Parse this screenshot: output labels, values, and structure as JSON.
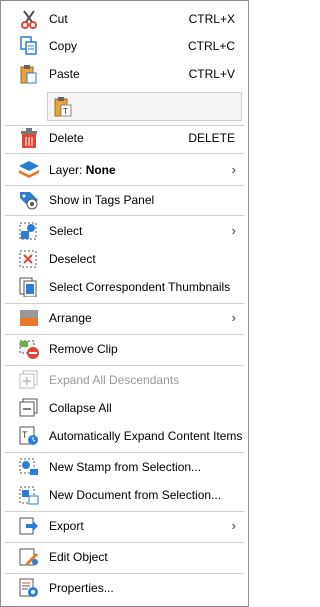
{
  "menu": {
    "cut": {
      "label": "Cut",
      "shortcut": "CTRL+X"
    },
    "copy": {
      "label": "Copy",
      "shortcut": "CTRL+C"
    },
    "paste": {
      "label": "Paste",
      "shortcut": "CTRL+V"
    },
    "delete": {
      "label": "Delete",
      "shortcut": "DELETE"
    },
    "layer": {
      "label": "Layer: ",
      "value": "None"
    },
    "show_in_tags": {
      "label": "Show in Tags Panel"
    },
    "select": {
      "label": "Select"
    },
    "deselect": {
      "label": "Deselect"
    },
    "select_thumbnails": {
      "label": "Select Correspondent Thumbnails"
    },
    "arrange": {
      "label": "Arrange"
    },
    "remove_clip": {
      "label": "Remove Clip"
    },
    "expand_all": {
      "label": "Expand All Descendants",
      "enabled": false
    },
    "collapse_all": {
      "label": "Collapse All"
    },
    "auto_expand": {
      "label": "Automatically Expand Content Items"
    },
    "new_stamp": {
      "label": "New Stamp from Selection..."
    },
    "new_document": {
      "label": "New Document from Selection..."
    },
    "export": {
      "label": "Export"
    },
    "edit_object": {
      "label": "Edit Object"
    },
    "properties": {
      "label": "Properties..."
    }
  },
  "submenu_arrow": "›",
  "colors": {
    "accent_blue": "#2a7fd4",
    "accent_orange": "#e8762b",
    "delete_red": "#d9432b",
    "separator": "#d0d0d0",
    "disabled_text": "#9a9a9a"
  }
}
